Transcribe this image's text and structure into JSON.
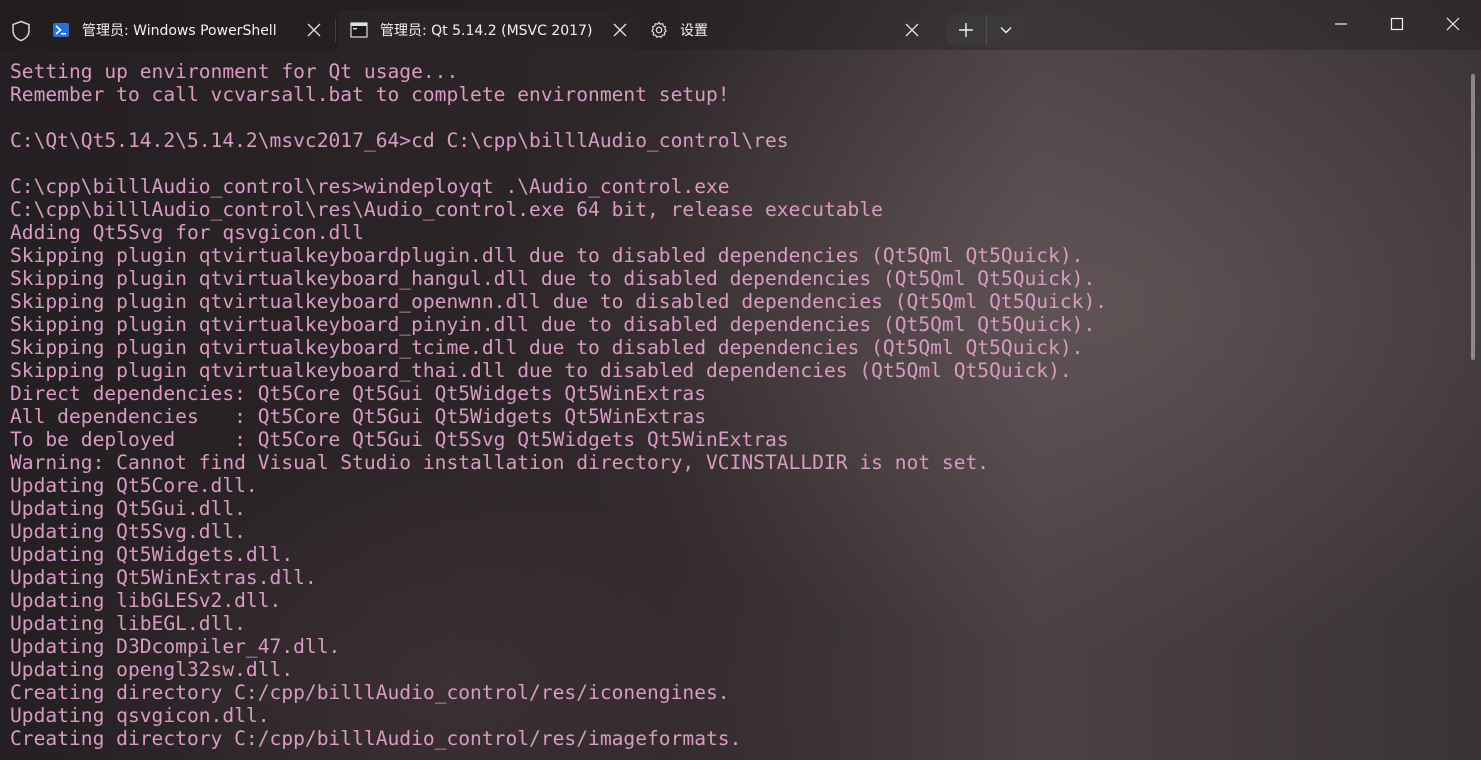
{
  "titlebar": {
    "tabs": [
      {
        "label": "管理员: Windows PowerShell",
        "icon": "powershell-icon"
      },
      {
        "label": "管理员: Qt 5.14.2 (MSVC 2017)",
        "icon": "console-icon"
      },
      {
        "label": "设置",
        "icon": "gear-icon"
      }
    ]
  },
  "colors": {
    "terminal_text": "#d99ac4",
    "active_tab": "#2a2425"
  },
  "terminal": {
    "lines": [
      "Setting up environment for Qt usage...",
      "Remember to call vcvarsall.bat to complete environment setup!",
      "",
      "C:\\Qt\\Qt5.14.2\\5.14.2\\msvc2017_64>cd C:\\cpp\\billlAudio_control\\res",
      "",
      "C:\\cpp\\billlAudio_control\\res>windeployqt .\\Audio_control.exe",
      "C:\\cpp\\billlAudio_control\\res\\Audio_control.exe 64 bit, release executable",
      "Adding Qt5Svg for qsvgicon.dll",
      "Skipping plugin qtvirtualkeyboardplugin.dll due to disabled dependencies (Qt5Qml Qt5Quick).",
      "Skipping plugin qtvirtualkeyboard_hangul.dll due to disabled dependencies (Qt5Qml Qt5Quick).",
      "Skipping plugin qtvirtualkeyboard_openwnn.dll due to disabled dependencies (Qt5Qml Qt5Quick).",
      "Skipping plugin qtvirtualkeyboard_pinyin.dll due to disabled dependencies (Qt5Qml Qt5Quick).",
      "Skipping plugin qtvirtualkeyboard_tcime.dll due to disabled dependencies (Qt5Qml Qt5Quick).",
      "Skipping plugin qtvirtualkeyboard_thai.dll due to disabled dependencies (Qt5Qml Qt5Quick).",
      "Direct dependencies: Qt5Core Qt5Gui Qt5Widgets Qt5WinExtras",
      "All dependencies   : Qt5Core Qt5Gui Qt5Widgets Qt5WinExtras",
      "To be deployed     : Qt5Core Qt5Gui Qt5Svg Qt5Widgets Qt5WinExtras",
      "Warning: Cannot find Visual Studio installation directory, VCINSTALLDIR is not set.",
      "Updating Qt5Core.dll.",
      "Updating Qt5Gui.dll.",
      "Updating Qt5Svg.dll.",
      "Updating Qt5Widgets.dll.",
      "Updating Qt5WinExtras.dll.",
      "Updating libGLESv2.dll.",
      "Updating libEGL.dll.",
      "Updating D3Dcompiler_47.dll.",
      "Updating opengl32sw.dll.",
      "Creating directory C:/cpp/billlAudio_control/res/iconengines.",
      "Updating qsvgicon.dll.",
      "Creating directory C:/cpp/billlAudio_control/res/imageformats."
    ]
  }
}
